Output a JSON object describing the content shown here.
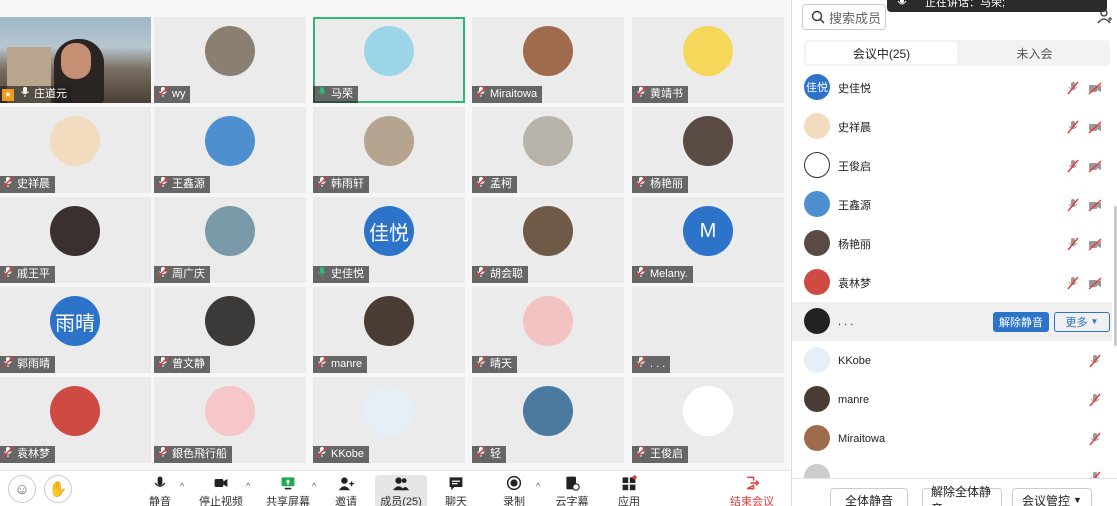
{
  "tiles": [
    {
      "name": "庄道元",
      "kind": "video",
      "host": true,
      "mic": "on"
    },
    {
      "name": "wy",
      "kind": "img",
      "color": "#8a7f70",
      "mic": "off"
    },
    {
      "name": "马荣",
      "kind": "img",
      "color": "#9cd4e8",
      "mic": "active",
      "speaking": true
    },
    {
      "name": "Miraitowa",
      "kind": "img",
      "color": "#a06a4d",
      "mic": "off"
    },
    {
      "name": "黄靖书",
      "kind": "img",
      "color": "#f5d85a",
      "mic": "off"
    },
    {
      "name": "史祥晨",
      "kind": "img",
      "color": "#f3dbbf",
      "mic": "off"
    },
    {
      "name": "王鑫源",
      "kind": "img",
      "color": "#4e8fcf",
      "mic": "off"
    },
    {
      "name": "韩雨轩",
      "kind": "img",
      "color": "#b4a490",
      "mic": "off"
    },
    {
      "name": "孟柯",
      "kind": "img",
      "color": "#b8b3aa",
      "mic": "off"
    },
    {
      "name": "杨艳丽",
      "kind": "img",
      "color": "#5a4a44",
      "mic": "off"
    },
    {
      "name": "戚王平",
      "kind": "img",
      "color": "#3a3030",
      "mic": "off"
    },
    {
      "name": "周广庆",
      "kind": "img",
      "color": "#7a9aaa",
      "mic": "off"
    },
    {
      "name": "史佳悦",
      "kind": "txt",
      "text": "佳悦",
      "mic": "active"
    },
    {
      "name": "胡会聪",
      "kind": "img",
      "color": "#6f5a48",
      "mic": "off"
    },
    {
      "name": "Melany.",
      "kind": "txt",
      "text": "M",
      "mic": "off"
    },
    {
      "name": "郭雨晴",
      "kind": "txt",
      "text": "雨晴",
      "mic": "off"
    },
    {
      "name": "曾文静",
      "kind": "img",
      "color": "#3c3a38",
      "mic": "off"
    },
    {
      "name": "manre",
      "kind": "img",
      "color": "#4a3c34",
      "mic": "off"
    },
    {
      "name": "晴天",
      "kind": "img",
      "color": "#f2c3c0",
      "mic": "off"
    },
    {
      "name": ". . .",
      "kind": "img",
      "color": "#ececec",
      "mic": "off"
    },
    {
      "name": "袁林梦",
      "kind": "img",
      "color": "#d04a44",
      "mic": "off"
    },
    {
      "name": "銀色飛行船",
      "kind": "img",
      "color": "#f6c6c8",
      "mic": "off"
    },
    {
      "name": "KKobe",
      "kind": "img",
      "color": "#e6eef6",
      "mic": "off"
    },
    {
      "name": "轻",
      "kind": "img",
      "color": "#4a7aa0",
      "mic": "off"
    },
    {
      "name": "王俊启",
      "kind": "img",
      "color": "#ffffff",
      "mic": "off"
    }
  ],
  "toolbar": {
    "buttons": [
      {
        "id": "mute",
        "label": "静音",
        "icon": "microphone-icon"
      },
      {
        "id": "video",
        "label": "停止视频",
        "icon": "camera-icon"
      },
      {
        "id": "share",
        "label": "共享屏幕",
        "icon": "share-screen-icon"
      },
      {
        "id": "invite",
        "label": "邀请",
        "icon": "add-user-icon"
      },
      {
        "id": "members",
        "label": "成员(25)",
        "icon": "members-icon",
        "active": true
      },
      {
        "id": "chat",
        "label": "聊天",
        "icon": "chat-icon"
      },
      {
        "id": "record",
        "label": "录制",
        "icon": "record-icon"
      },
      {
        "id": "minutes",
        "label": "云字幕",
        "icon": "minutes-icon"
      },
      {
        "id": "apps",
        "label": "应用",
        "icon": "apps-icon"
      },
      {
        "id": "end",
        "label": "结束会议",
        "icon": "exit-icon"
      }
    ]
  },
  "panel": {
    "search_placeholder": "搜索成员",
    "toast_text": "正在讲话：马荣;",
    "tabs": [
      "会议中(25)",
      "未入会"
    ],
    "members": [
      {
        "name": "史佳悦",
        "avatar_text": "佳悦",
        "avatar_color": "#2c73c9",
        "video": true
      },
      {
        "name": "史祥晨",
        "avatar_text": "",
        "avatar_color": "#f3dbbf",
        "video": true
      },
      {
        "name": "王俊启",
        "avatar_text": "",
        "avatar_color": "#ffffff",
        "video": true
      },
      {
        "name": "王鑫源",
        "avatar_text": "",
        "avatar_color": "#4e8fcf",
        "video": true
      },
      {
        "name": "杨艳丽",
        "avatar_text": "",
        "avatar_color": "#5a4a44",
        "video": true
      },
      {
        "name": "袁林梦",
        "avatar_text": "",
        "avatar_color": "#d04a44",
        "video": true
      },
      {
        "name": ". . .",
        "avatar_text": "",
        "avatar_color": "#222222",
        "video": false,
        "highlight": true,
        "action1": "解除静音",
        "action2": "更多"
      },
      {
        "name": "KKobe",
        "avatar_text": "",
        "avatar_color": "#e6eef6",
        "video": false
      },
      {
        "name": "manre",
        "avatar_text": "",
        "avatar_color": "#4a3c34",
        "video": false
      },
      {
        "name": "Miraitowa",
        "avatar_text": "",
        "avatar_color": "#a06a4d",
        "video": false
      },
      {
        "name": ".....",
        "avatar_text": "",
        "avatar_color": "#cccccc",
        "video": false
      }
    ],
    "footer": {
      "mute_all": "全体静音",
      "unmute_all": "解除全体静音",
      "control": "会议管控"
    }
  },
  "colors": {
    "accent": "#2c73c9",
    "speaking": "#2eb872",
    "danger": "#e53935"
  }
}
